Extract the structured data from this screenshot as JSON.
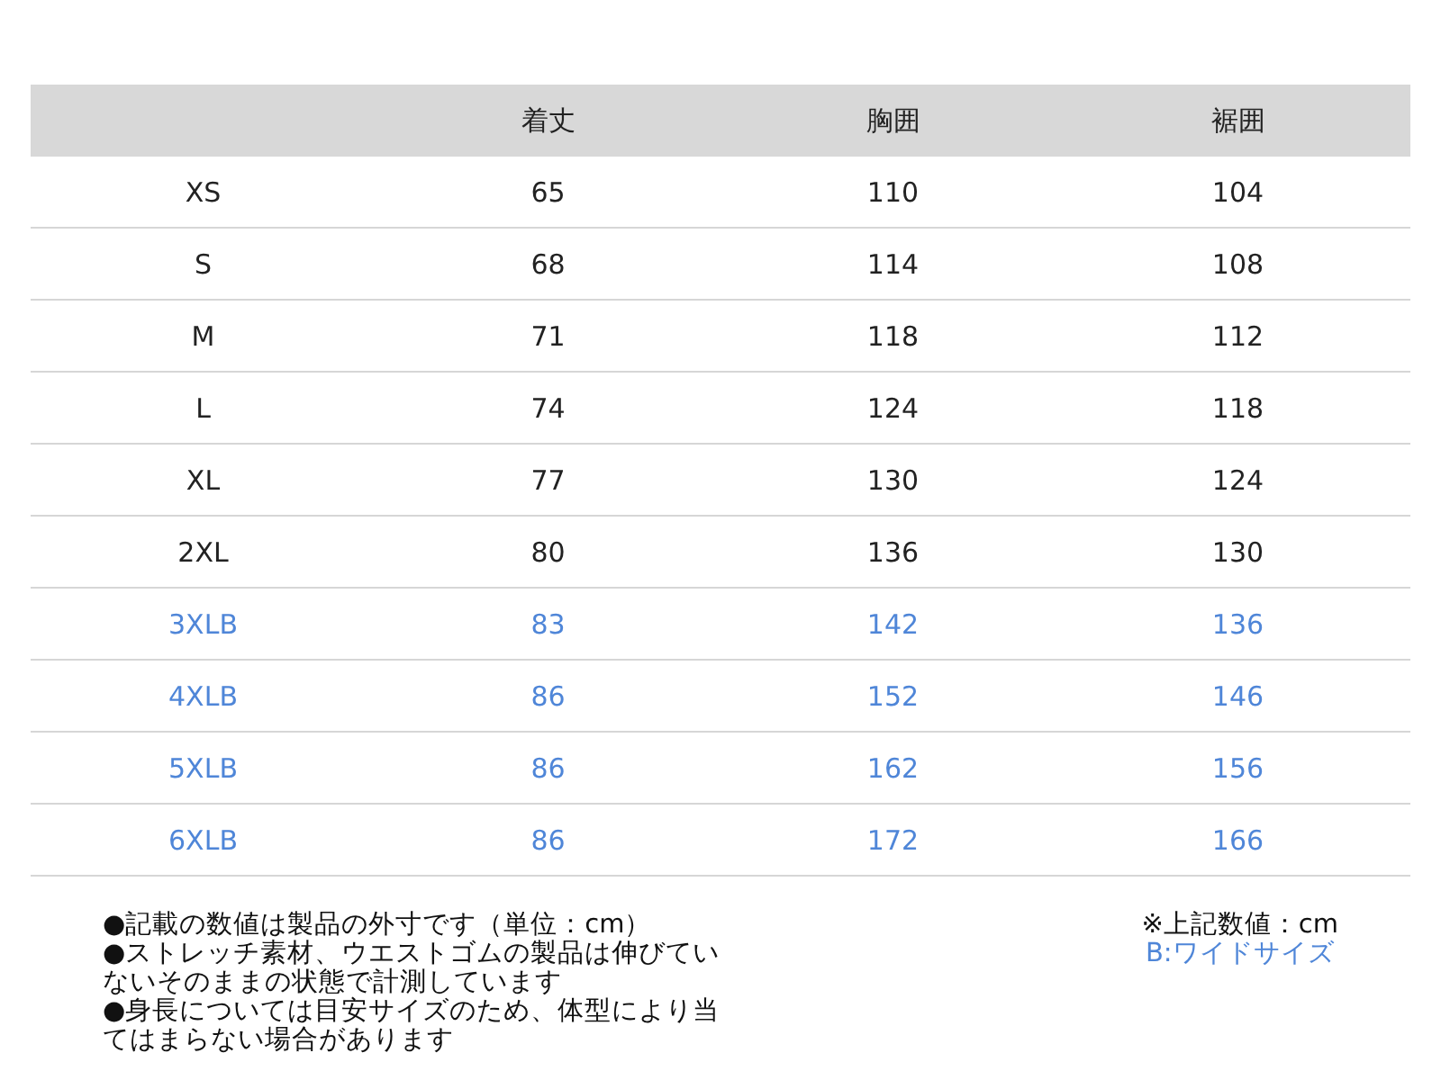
{
  "table": {
    "columns": [
      "",
      "着丈",
      "胸囲",
      "裾囲"
    ],
    "rows": [
      {
        "kind": "regular",
        "cells": [
          "XS",
          "65",
          "110",
          "104"
        ]
      },
      {
        "kind": "regular",
        "cells": [
          "S",
          "68",
          "114",
          "108"
        ]
      },
      {
        "kind": "regular",
        "cells": [
          "M",
          "71",
          "118",
          "112"
        ]
      },
      {
        "kind": "regular",
        "cells": [
          "L",
          "74",
          "124",
          "118"
        ]
      },
      {
        "kind": "regular",
        "cells": [
          "XL",
          "77",
          "130",
          "124"
        ]
      },
      {
        "kind": "regular",
        "cells": [
          "2XL",
          "80",
          "136",
          "130"
        ]
      },
      {
        "kind": "wide",
        "cells": [
          "3XLB",
          "83",
          "142",
          "136"
        ]
      },
      {
        "kind": "wide",
        "cells": [
          "4XLB",
          "86",
          "152",
          "146"
        ]
      },
      {
        "kind": "wide",
        "cells": [
          "5XLB",
          "86",
          "162",
          "156"
        ]
      },
      {
        "kind": "wide",
        "cells": [
          "6XLB",
          "86",
          "172",
          "166"
        ]
      }
    ]
  },
  "notes": [
    "●記載の数値は製品の外寸です（単位：cm）",
    "●ストレッチ素材、ウエストゴムの製品は伸びていないそのままの状態で計測しています",
    "●身長については目安サイズのため、体型により当てはまらない場合があります"
  ],
  "unit_note": "※上記数値：cm",
  "legend": "B:ワイドサイズ"
}
